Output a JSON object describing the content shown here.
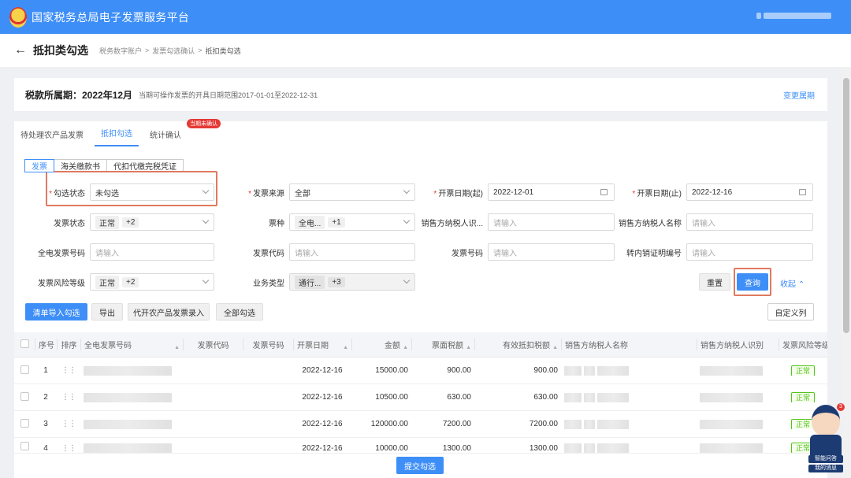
{
  "app": {
    "title": "国家税务总局电子发票服务平台"
  },
  "page": {
    "title": "抵扣类勾选",
    "breadcrumb": [
      "税务数字账户",
      "发票勾选确认",
      "抵扣类勾选"
    ]
  },
  "period": {
    "label": "税款所属期：2022年12月",
    "note": "当期可操作发票的开具日期范围2017-01-01至2022-12-31",
    "change_link": "变更属期"
  },
  "tabs": [
    {
      "label": "待处理农产品发票",
      "active": false
    },
    {
      "label": "抵扣勾选",
      "active": true
    },
    {
      "label": "统计确认",
      "active": false,
      "badge": "当期未确认"
    }
  ],
  "subtabs": [
    {
      "label": "发票",
      "active": true
    },
    {
      "label": "海关缴款书",
      "active": false
    },
    {
      "label": "代扣代缴完税凭证",
      "active": false
    }
  ],
  "filters": {
    "check_status": {
      "label": "勾选状态",
      "value": "未勾选"
    },
    "invoice_source": {
      "label": "发票来源",
      "value": "全部"
    },
    "issue_date_start": {
      "label": "开票日期(起)",
      "value": "2022-12-01"
    },
    "issue_date_end": {
      "label": "开票日期(止)",
      "value": "2022-12-16"
    },
    "invoice_status": {
      "label": "发票状态",
      "tag": "正常",
      "more": "+2"
    },
    "invoice_type": {
      "label": "票种",
      "tag": "全电...",
      "more": "+1"
    },
    "seller_tax_id": {
      "label": "销售方纳税人识...",
      "placeholder": "请输入"
    },
    "seller_name": {
      "label": "销售方纳税人名称",
      "placeholder": "请输入"
    },
    "fulldigital_no": {
      "label": "全电发票号码",
      "placeholder": "请输入"
    },
    "invoice_code": {
      "label": "发票代码",
      "placeholder": "请输入"
    },
    "invoice_no": {
      "label": "发票号码",
      "placeholder": "请输入"
    },
    "transfer_no": {
      "label": "转内销证明编号",
      "placeholder": "请输入"
    },
    "risk_level": {
      "label": "发票风险等级",
      "tag": "正常",
      "more": "+2"
    },
    "business_type": {
      "label": "业务类型",
      "tag": "通行...",
      "more": "+3"
    }
  },
  "actions": {
    "reset": "重置",
    "query": "查询",
    "collapse": "收起",
    "import_check": "清单导入勾选",
    "export": "导出",
    "agri_entry": "代开农产品发票录入",
    "check_all": "全部勾选",
    "custom_cols": "自定义列",
    "submit": "提交勾选"
  },
  "table": {
    "headers": [
      "序号",
      "排序",
      "全电发票号码",
      "发票代码",
      "发票号码",
      "开票日期",
      "金额",
      "票面税额",
      "有效抵扣税额",
      "销售方纳税人名称",
      "销售方纳税人识别",
      "发票风险等级"
    ],
    "rows": [
      {
        "no": "1",
        "date": "2022-12-16",
        "amount": "15000.00",
        "tax": "900.00",
        "deductible": "900.00",
        "risk": "正常"
      },
      {
        "no": "2",
        "date": "2022-12-16",
        "amount": "10500.00",
        "tax": "630.00",
        "deductible": "630.00",
        "risk": "正常"
      },
      {
        "no": "3",
        "date": "2022-12-16",
        "amount": "120000.00",
        "tax": "7200.00",
        "deductible": "7200.00",
        "risk": "正常"
      },
      {
        "no": "4",
        "date": "2022-12-16",
        "amount": "10000.00",
        "tax": "1300.00",
        "deductible": "1300.00",
        "risk": "正常"
      }
    ]
  },
  "assistant": {
    "line1": "智能问答",
    "line2": "我的消息",
    "badge": "3"
  }
}
